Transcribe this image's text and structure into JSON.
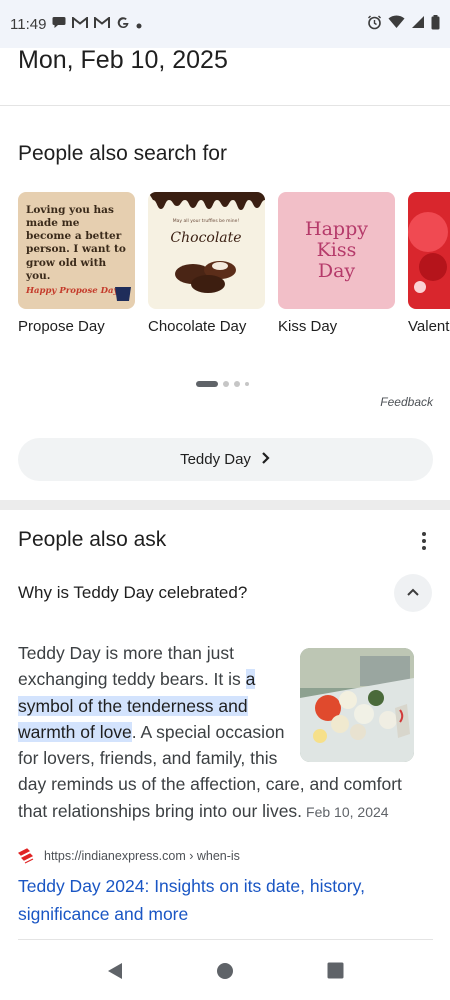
{
  "status_bar": {
    "time": "11:49",
    "left_icons": [
      "chat-icon",
      "gmail-icon",
      "gmail-icon",
      "google-icon",
      "dot-icon"
    ],
    "right_icons": [
      "alarm-icon",
      "wifi-icon",
      "signal-icon",
      "battery-icon"
    ]
  },
  "top": {
    "date": "Mon, Feb 10, 2025"
  },
  "people_also_search": {
    "title": "People also search for",
    "items": [
      {
        "label": "Propose Day",
        "image_text": "Loving you has made me become a better person. I want to grow old with you.",
        "image_subtext": "Happy Propose Day!"
      },
      {
        "label": "Chocolate Day",
        "image_text": "Chocolate",
        "image_subtext": "May all your truffles be mine!"
      },
      {
        "label": "Kiss Day",
        "image_text": "Happy Kiss Day"
      },
      {
        "label": "Valent"
      }
    ],
    "feedback": "Feedback",
    "more_button": "Teddy Day"
  },
  "people_also_ask": {
    "title": "People also ask",
    "question": "Why is Teddy Day celebrated?",
    "answer_before": "Teddy Day is more than just exchanging teddy bears. It is ",
    "answer_highlight": "a symbol of the tenderness and warmth of love",
    "answer_after": ". A special occasion for lovers, friends, and family, this day reminds us of the affection, care, and comfort that relationships bring into our lives.",
    "answer_date": "Feb 10, 2024",
    "source_url": "https://indianexpress.com › when-is",
    "result_title": "Teddy Day 2024: Insights on its date, history, significance and more"
  },
  "colors": {
    "link": "#1a56c4",
    "highlight": "#d3e3fd",
    "source_logo": "#e02424"
  }
}
